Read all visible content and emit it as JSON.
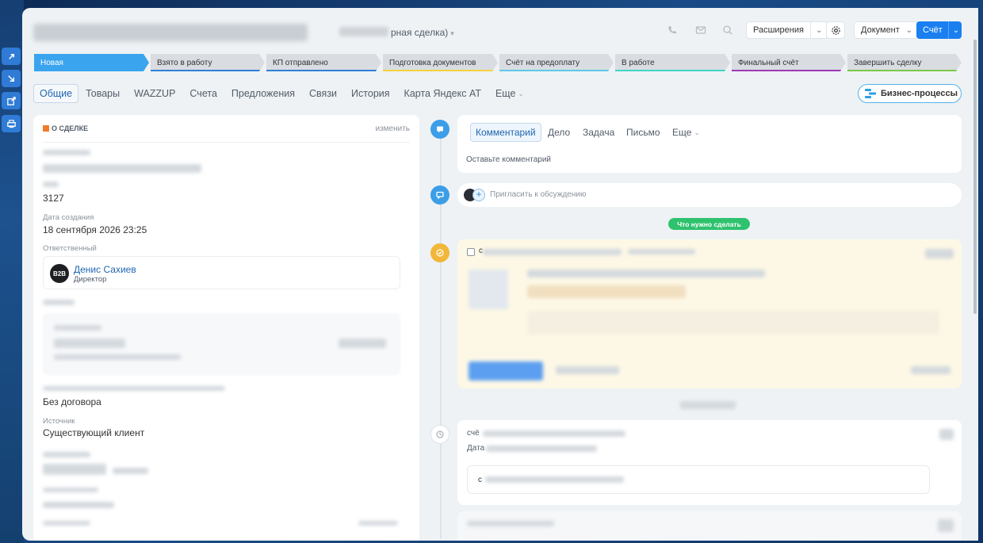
{
  "header": {
    "stage_label": "рная сделка)",
    "extensions_label": "Расширения",
    "document_label": "Документ",
    "invoice_label": "Счёт"
  },
  "pipeline": [
    {
      "label": "Новая",
      "color": "#3aa4ee",
      "active": true
    },
    {
      "label": "Взято в работу",
      "color": "#2f7fd6"
    },
    {
      "label": "КП отправлено",
      "color": "#2f7fd6"
    },
    {
      "label": "Подготовка документов",
      "color": "#f2d23e"
    },
    {
      "label": "Счёт на предоплату",
      "color": "#61c6e8"
    },
    {
      "label": "В работе",
      "color": "#44d3c8"
    },
    {
      "label": "Финальный счёт",
      "color": "#9d3ab5"
    },
    {
      "label": "Завершить сделку",
      "color": "#7cc84a"
    }
  ],
  "tabs": [
    "Общие",
    "Товары",
    "WAZZUP",
    "Счета",
    "Предложения",
    "Связи",
    "История",
    "Карта Яндекс АТ",
    "Еще"
  ],
  "business_processes_label": "Бизнес-процессы",
  "about": {
    "heading": "О СДЕЛКЕ",
    "edit_label": "изменить",
    "id_value": "3127",
    "created_label": "Дата создания",
    "created_value": "18 сентября 2026 23:25",
    "responsible_label": "Ответственный",
    "responsible_name": "Денис Сахиев",
    "responsible_role": "Директор",
    "avatar_text": "B2B",
    "contract_value": "Без договора",
    "source_label": "Источник",
    "source_value": "Существующий клиент"
  },
  "composer": {
    "tabs": [
      "Комментарий",
      "Дело",
      "Задача",
      "Письмо",
      "Еще"
    ],
    "placeholder": "Оставьте комментарий"
  },
  "invite_text": "Пригласить к обсуждению",
  "todo_label": "Что нужно сделать",
  "task_prefix": "с",
  "history_prefix": "счё",
  "history_date_prefix": "Дата",
  "history_box_prefix": "с"
}
